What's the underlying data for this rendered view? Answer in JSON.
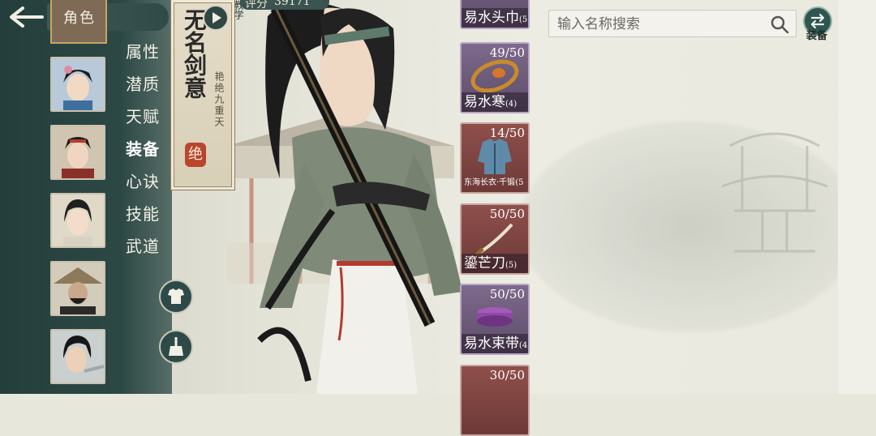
{
  "header": {
    "title": "角色",
    "back_icon": "back-arrow-icon"
  },
  "sidebar": {
    "tabs": [
      {
        "label": "属性",
        "active": false
      },
      {
        "label": "潜质",
        "active": false
      },
      {
        "label": "天赋",
        "active": false
      },
      {
        "label": "装备",
        "active": true
      },
      {
        "label": "心诀",
        "active": false
      },
      {
        "label": "技能",
        "active": false
      },
      {
        "label": "武道",
        "active": false
      }
    ],
    "tool_buttons": [
      "outfit-icon",
      "broom-icon"
    ]
  },
  "banner": {
    "title": "无名剑意",
    "subtitle": "艳绝九重天",
    "seal": "绝",
    "teach_label": "教学"
  },
  "score": {
    "label": "评分",
    "value": "39171"
  },
  "items": [
    {
      "name": "易水头巾",
      "level": "(5)",
      "count": "",
      "rarity": "purple"
    },
    {
      "name": "易水寒",
      "level": "(4)",
      "count": "49/50",
      "rarity": "purple"
    },
    {
      "name": "东海长衣·千锻",
      "level": "(5",
      "count": "14/50",
      "rarity": "red"
    },
    {
      "name": "鎏芒刀",
      "level": "(5)",
      "count": "50/50",
      "rarity": "red"
    },
    {
      "name": "易水束带",
      "level": "(4)",
      "count": "50/50",
      "rarity": "purple"
    },
    {
      "name": "",
      "level": "",
      "count": "30/50",
      "rarity": "red"
    }
  ],
  "search": {
    "placeholder": "输入名称搜索",
    "value": ""
  },
  "equip_button": {
    "label": "装备"
  },
  "colors": {
    "sidebar": "#2c4845",
    "purple": "#6f5b7c",
    "red": "#7c4441",
    "accent": "#c8a466"
  }
}
